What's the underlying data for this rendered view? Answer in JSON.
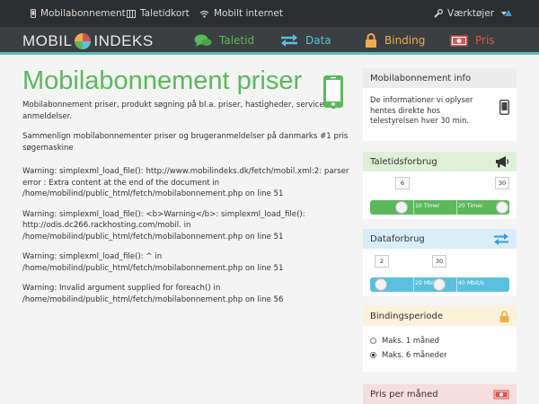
{
  "topnav": {
    "items": [
      {
        "label": "Mobilabonnement",
        "icon": "mobile-icon"
      },
      {
        "label": "Taletidkort",
        "icon": "sim-card-icon"
      },
      {
        "label": "Mobilt internet",
        "icon": "wifi-icon"
      }
    ],
    "tools_label": "Værktøjer",
    "tools_icon": "wrench-icon"
  },
  "logo": {
    "part1": "MOBIL",
    "part2": "INDEKS"
  },
  "mainnav": [
    {
      "label": "Taletid",
      "icon": "chat-bubbles-icon",
      "color": "#5cb85c"
    },
    {
      "label": "Data",
      "icon": "exchange-arrows-icon",
      "color": "#5bc0de"
    },
    {
      "label": "Binding",
      "icon": "lock-icon",
      "color": "#f0ad4e"
    },
    {
      "label": "Pris",
      "icon": "money-icon",
      "color": "#d9534f"
    }
  ],
  "main": {
    "title": "Mobilabonnement priser",
    "intro1": "Mobilabonnement priser, produkt søgning på bl.a. priser, hastigheder, service og anmeldelser.",
    "intro2": "Sammenlign mobilabonnementer priser og brugeranmeldelser på danmarks #1 pris søgemaskine",
    "warnings": [
      "Warning: simplexml_load_file(): http://www.mobilindeks.dk/fetch/mobil.xml:2: parser error : Extra content at the end of the document in /home/mobilind/public_html/fetch/mobilabonnement.php on line 51",
      "Warning: simplexml_load_file(): <b>Warning</b>: simplexml_load_file(): http://odis.dc266.rackhosting.com/mobil. in /home/mobilind/public_html/fetch/mobilabonnement.php on line 51",
      "Warning: simplexml_load_file(): ^ in /home/mobilind/public_html/fetch/mobilabonnement.php on line 51",
      "Warning: Invalid argument supplied for foreach() in /home/mobilind/public_html/fetch/mobilabonnement.php on line 56"
    ]
  },
  "sidebar": {
    "info": {
      "title": "Mobilabonnement info",
      "text": "De informationer vi oplyser hentes direkte hos telestyrelsen hver 30 min."
    },
    "taletid": {
      "title": "Taletidsforbrug",
      "min_value": "6",
      "max_value": "30",
      "label1": "10 Timer",
      "label2": "20 Timer",
      "color": "#5cb85c"
    },
    "data": {
      "title": "Dataforbrug",
      "min_value": "2",
      "max_value": "30",
      "label1": "20 Mbit/s",
      "label2": "40 Mbit/s",
      "color": "#5bc0de"
    },
    "binding": {
      "title": "Bindingsperiode",
      "options": [
        "Maks. 1 måned",
        "Maks. 6 måneder"
      ],
      "selected": 1
    },
    "pris": {
      "title": "Pris per måned"
    }
  }
}
